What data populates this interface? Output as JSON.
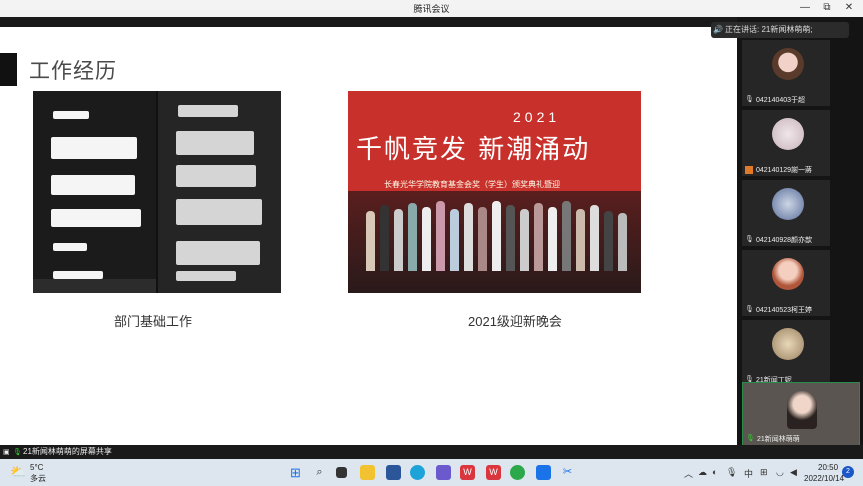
{
  "window": {
    "title": "腾讯会议",
    "min": "—",
    "max": "⧉",
    "close": "✕"
  },
  "slide": {
    "heading": "工作经历",
    "caption_left": "部门基础工作",
    "caption_right": "2021级迎新晚会",
    "photo_title": "千帆竞发 新潮涌动",
    "photo_year": "2021",
    "photo_subtitle": "长春光华学院教育基金会奖（学生）颁奖典礼暨迎"
  },
  "speaking": {
    "label": "正在讲话: 21新闻林萌萌;"
  },
  "participants": [
    {
      "name": "042140403于超"
    },
    {
      "name": "042140129謝一蔣"
    },
    {
      "name": "042140928颜亦歆"
    },
    {
      "name": "042140523柯王婷"
    },
    {
      "name": "21新闻丁妮"
    },
    {
      "name": "21新闻林萌萌"
    }
  ],
  "share_bar": {
    "text": "21新闻林萌萌的屏幕共享"
  },
  "taskbar": {
    "weather_temp": "5°C",
    "weather_desc": "多云",
    "ime": "中",
    "time": "20:50",
    "date": "2022/10/14",
    "notification_count": "2"
  }
}
